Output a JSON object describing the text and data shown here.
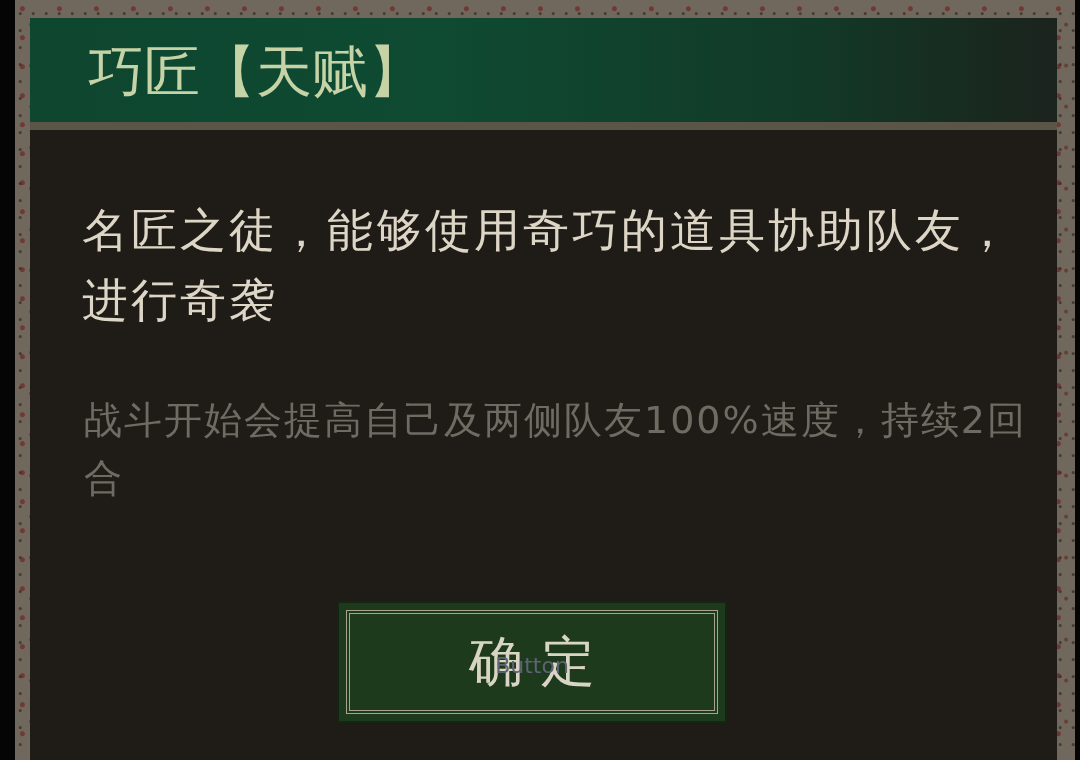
{
  "dialog": {
    "title": "巧匠【天赋】",
    "description": "名匠之徒，能够使用奇巧的道具协助队友，进行奇袭",
    "effect": "战斗开始会提高自己及两侧队友100%速度，持续2回合",
    "confirm_button": {
      "label": "确 定",
      "overlay_label": "Button"
    }
  }
}
